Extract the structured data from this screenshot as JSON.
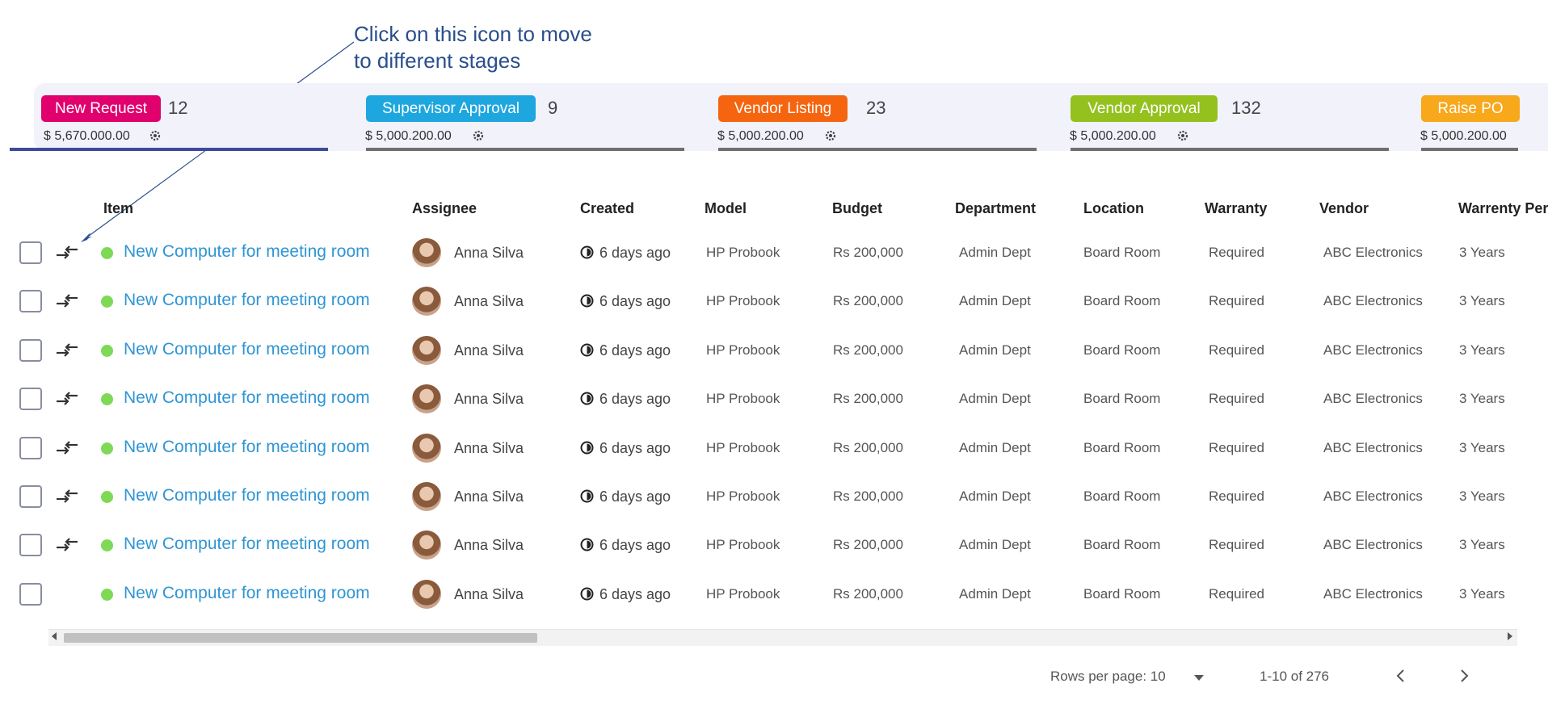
{
  "annotation": {
    "line1": "Click on this icon to move",
    "line2": "to different stages"
  },
  "stages": [
    {
      "label": "New Request",
      "count": "12",
      "amount": "$ 5,670.000.00",
      "color": "#e0006e",
      "active": true
    },
    {
      "label": "Supervisor Approval",
      "count": "9",
      "amount": "$ 5,000.200.00",
      "color": "#1ea7df",
      "active": false
    },
    {
      "label": "Vendor Listing",
      "count": "23",
      "amount": "$ 5,000.200.00",
      "color": "#f5650f",
      "active": false
    },
    {
      "label": "Vendor Approval",
      "count": "132",
      "amount": "$ 5,000.200.00",
      "color": "#95c11f",
      "active": false
    },
    {
      "label": "Raise PO",
      "count": "",
      "amount": "$ 5,000.200.00",
      "color": "#f7a81b",
      "active": false
    }
  ],
  "table": {
    "columns": [
      "Item",
      "Assignee",
      "Created",
      "Model",
      "Budget",
      "Department",
      "Location",
      "Warranty",
      "Vendor",
      "Warrenty Peri"
    ],
    "rows": [
      {
        "item": "New Computer for meeting room",
        "assignee": "Anna Silva",
        "created": "6 days ago",
        "model": "HP Probook",
        "budget": "Rs 200,000",
        "department": "Admin Dept",
        "location": "Board Room",
        "warranty": "Required",
        "vendor": "ABC Electronics",
        "period": "3 Years",
        "move_icon": true
      },
      {
        "item": "New Computer for meeting room",
        "assignee": "Anna Silva",
        "created": "6 days ago",
        "model": "HP Probook",
        "budget": "Rs 200,000",
        "department": "Admin Dept",
        "location": "Board Room",
        "warranty": "Required",
        "vendor": "ABC Electronics",
        "period": "3 Years",
        "move_icon": true
      },
      {
        "item": "New Computer for meeting room",
        "assignee": "Anna Silva",
        "created": "6 days ago",
        "model": "HP Probook",
        "budget": "Rs 200,000",
        "department": "Admin Dept",
        "location": "Board Room",
        "warranty": "Required",
        "vendor": "ABC Electronics",
        "period": "3 Years",
        "move_icon": true
      },
      {
        "item": "New Computer for meeting room",
        "assignee": "Anna Silva",
        "created": "6 days ago",
        "model": "HP Probook",
        "budget": "Rs 200,000",
        "department": "Admin Dept",
        "location": "Board Room",
        "warranty": "Required",
        "vendor": "ABC Electronics",
        "period": "3 Years",
        "move_icon": true
      },
      {
        "item": "New Computer for meeting room",
        "assignee": "Anna Silva",
        "created": "6 days ago",
        "model": "HP Probook",
        "budget": "Rs 200,000",
        "department": "Admin Dept",
        "location": "Board Room",
        "warranty": "Required",
        "vendor": "ABC Electronics",
        "period": "3 Years",
        "move_icon": true
      },
      {
        "item": "New Computer for meeting room",
        "assignee": "Anna Silva",
        "created": "6 days ago",
        "model": "HP Probook",
        "budget": "Rs 200,000",
        "department": "Admin Dept",
        "location": "Board Room",
        "warranty": "Required",
        "vendor": "ABC Electronics",
        "period": "3 Years",
        "move_icon": true
      },
      {
        "item": "New Computer for meeting room",
        "assignee": "Anna Silva",
        "created": "6 days ago",
        "model": "HP Probook",
        "budget": "Rs 200,000",
        "department": "Admin Dept",
        "location": "Board Room",
        "warranty": "Required",
        "vendor": "ABC Electronics",
        "period": "3 Years",
        "move_icon": true
      },
      {
        "item": "New Computer for meeting room",
        "assignee": "Anna Silva",
        "created": "6 days ago",
        "model": "HP Probook",
        "budget": "Rs 200,000",
        "department": "Admin Dept",
        "location": "Board Room",
        "warranty": "Required",
        "vendor": "ABC Electronics",
        "period": "3 Years",
        "move_icon": false
      }
    ]
  },
  "pagination": {
    "rows_per_page_label": "Rows per page: 10",
    "range": "1-10 of 276"
  },
  "icons": {
    "move": "move-stage-icon",
    "gear": "gear-icon",
    "clock": "clock-icon",
    "prev": "chevron-left-icon",
    "next": "chevron-right-icon"
  },
  "colors": {
    "link": "#2f95d4",
    "status_dot": "#7ed957",
    "active_underline": "#3f4a9a",
    "annotation": "#2a4e8c"
  }
}
